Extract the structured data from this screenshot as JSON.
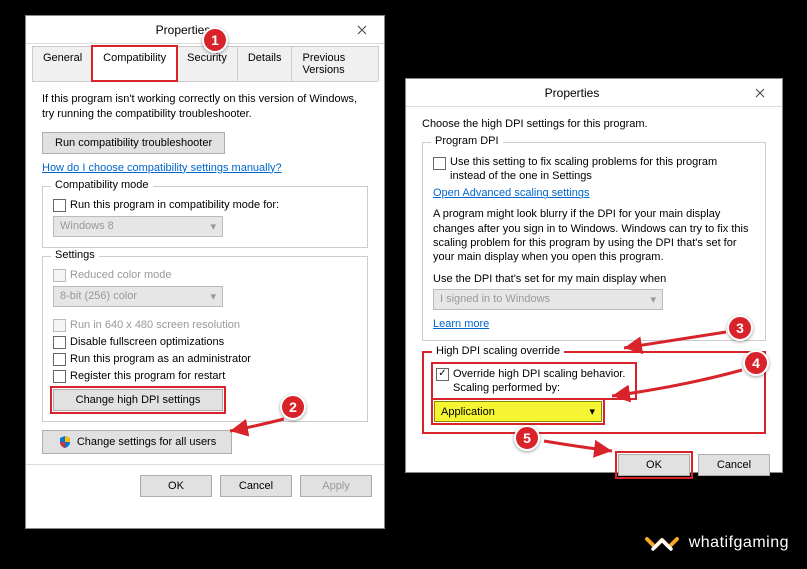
{
  "dialog1": {
    "title": "Properties",
    "tabs": [
      "General",
      "Compatibility",
      "Security",
      "Details",
      "Previous Versions"
    ],
    "active_tab": "Compatibility",
    "intro": "If this program isn't working correctly on this version of Windows, try running the compatibility troubleshooter.",
    "troubleshooter_btn": "Run compatibility troubleshooter",
    "manual_link": "How do I choose compatibility settings manually?",
    "compat_mode": {
      "legend": "Compatibility mode",
      "check_label": "Run this program in compatibility mode for:",
      "select_value": "Windows 8"
    },
    "settings": {
      "legend": "Settings",
      "reduced_color": "Reduced color mode",
      "color_select": "8-bit (256) color",
      "run_640": "Run in 640 x 480 screen resolution",
      "disable_fullscreen": "Disable fullscreen optimizations",
      "run_admin": "Run this program as an administrator",
      "register_restart": "Register this program for restart",
      "change_dpi_btn": "Change high DPI settings"
    },
    "change_all_users_btn": "Change settings for all users",
    "ok": "OK",
    "cancel": "Cancel",
    "apply": "Apply"
  },
  "dialog2": {
    "title": "Properties",
    "intro": "Choose the high DPI settings for this program.",
    "program_dpi": {
      "legend": "Program DPI",
      "check_label": "Use this setting to fix scaling problems for this program instead of the one in Settings",
      "advanced_link": "Open Advanced scaling settings",
      "description": "A program might look blurry if the DPI for your main display changes after you sign in to Windows. Windows can try to fix this scaling problem for this program by using the DPI that's set for your main display when you open this program.",
      "use_label": "Use the DPI that's set for my main display when",
      "select_value": "I signed in to Windows",
      "learn_more": "Learn more"
    },
    "override": {
      "legend": "High DPI scaling override",
      "check_label": "Override high DPI scaling behavior.\nScaling performed by:",
      "select_value": "Application"
    },
    "ok": "OK",
    "cancel": "Cancel"
  },
  "badges": {
    "b1": "1",
    "b2": "2",
    "b3": "3",
    "b4": "4",
    "b5": "5"
  },
  "logo_text": "whatifgaming"
}
